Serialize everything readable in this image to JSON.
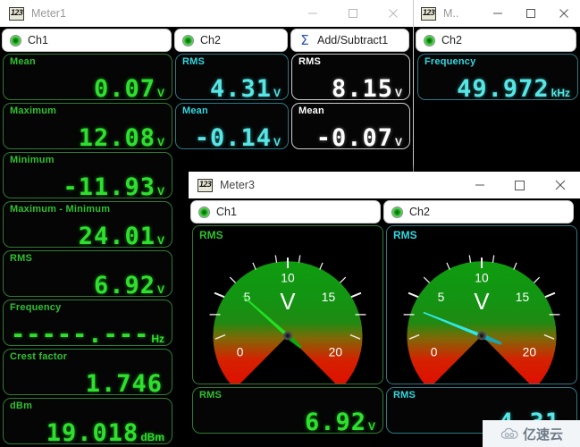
{
  "theme": {
    "green": "#2ee02e",
    "cyan": "#57e6e6",
    "white": "#ffffff",
    "window_bg": "#000000",
    "titlebar_bg": "#ffffff"
  },
  "windows": {
    "meter1": {
      "title": "Meter1",
      "icon": "seven-segment-icon",
      "active": false,
      "buttons": {
        "minimize": "–",
        "maximize": "□",
        "close": "✕"
      },
      "tabs": [
        {
          "label": "Ch1",
          "icon": "channel-led-icon",
          "selected": true
        },
        {
          "label": "Ch2",
          "icon": "channel-led-icon",
          "selected": false
        },
        {
          "label": "Add/Subtract1",
          "icon": "sigma-icon",
          "selected": false
        }
      ],
      "columns": [
        {
          "name": "Ch1",
          "color": "green",
          "readouts": [
            {
              "caption": "Mean",
              "value": "0.07",
              "unit": "V"
            },
            {
              "caption": "Maximum",
              "value": "12.08",
              "unit": "V"
            },
            {
              "caption": "Minimum",
              "value": "-11.93",
              "unit": "V"
            },
            {
              "caption": "Maximum - Minimum",
              "value": "24.01",
              "unit": "V"
            },
            {
              "caption": "RMS",
              "value": "6.92",
              "unit": "V"
            },
            {
              "caption": "Frequency",
              "value": "-----.---",
              "unit": "Hz"
            },
            {
              "caption": "Crest factor",
              "value": "1.746",
              "unit": ""
            },
            {
              "caption": "dBm",
              "value": "19.018",
              "unit": "dBm"
            }
          ]
        },
        {
          "name": "Ch2",
          "color": "cyan",
          "readouts": [
            {
              "caption": "RMS",
              "value": "4.31",
              "unit": "V"
            },
            {
              "caption": "Mean",
              "value": "-0.14",
              "unit": "V"
            }
          ]
        },
        {
          "name": "Add/Subtract1",
          "color": "white",
          "readouts": [
            {
              "caption": "RMS",
              "value": "8.15",
              "unit": "V"
            },
            {
              "caption": "Mean",
              "value": "-0.07",
              "unit": "V"
            }
          ]
        }
      ]
    },
    "meter2": {
      "title": "M..",
      "icon": "seven-segment-icon",
      "active": true,
      "buttons": {
        "minimize": "–",
        "maximize": "□",
        "close": "✕"
      },
      "tabs": [
        {
          "label": "Ch2",
          "icon": "channel-led-icon",
          "selected": true
        }
      ],
      "readouts": [
        {
          "caption": "Frequency",
          "value": "49.972",
          "unit": "kHz",
          "color": "cyan"
        }
      ]
    },
    "meter3": {
      "title": "Meter3",
      "icon": "seven-segment-icon",
      "active": true,
      "buttons": {
        "minimize": "–",
        "maximize": "□",
        "close": "✕"
      },
      "tabs": [
        {
          "label": "Ch1",
          "icon": "channel-led-icon",
          "selected": true
        },
        {
          "label": "Ch2",
          "icon": "channel-led-icon",
          "selected": false
        }
      ],
      "gauges": [
        {
          "caption": "RMS",
          "color": "green",
          "needle_color": "#22e022",
          "unit_symbol": "V",
          "ticks": [
            "0",
            "5",
            "10",
            "15",
            "20"
          ],
          "scale_min": 0,
          "scale_max": 20,
          "value": 6.92
        },
        {
          "caption": "RMS",
          "color": "cyan",
          "needle_color": "#2ee9e9",
          "unit_symbol": "V",
          "ticks": [
            "0",
            "5",
            "10",
            "15",
            "20"
          ],
          "scale_min": 0,
          "scale_max": 20,
          "value": 4.31
        }
      ],
      "readouts": [
        {
          "caption": "RMS",
          "value": "6.92",
          "unit": "V",
          "color": "green"
        },
        {
          "caption": "RMS",
          "value": "4.31",
          "unit": "V",
          "color": "cyan"
        }
      ]
    }
  },
  "watermark": {
    "text": "亿速云",
    "icon": "cloud-icon"
  }
}
